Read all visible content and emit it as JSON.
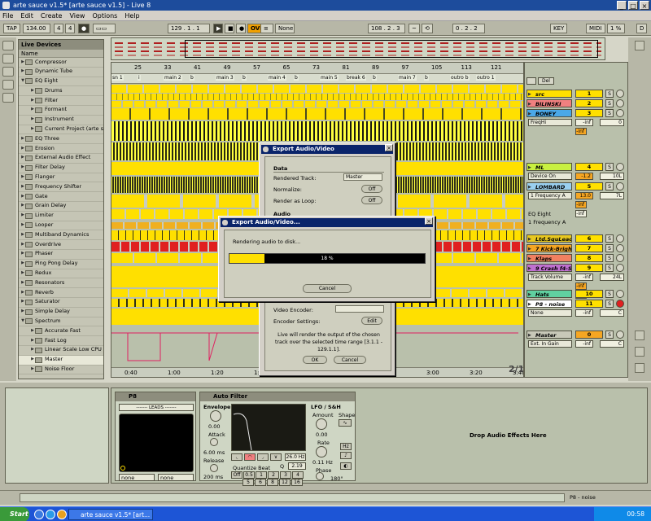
{
  "window": {
    "title": "arte sauce v1.5*  [arte sauce v1.5]  - Live 8"
  },
  "menu": [
    "File",
    "Edit",
    "Create",
    "View",
    "Options",
    "Help"
  ],
  "transport": {
    "tap": "TAP",
    "tempo": "134.00",
    "meter_num": "4",
    "meter_den": "4",
    "position": "129 . 1 . 1",
    "ovr": "OVR",
    "quantize": "None",
    "loop_start": "108 . 2 . 3",
    "loop_length": "0 . 2 . 2",
    "key": "KEY",
    "midi": "MIDI",
    "cpu": "1 %",
    "d": "D"
  },
  "browser": {
    "header": "Live Devices",
    "name_col": "Name",
    "items": [
      {
        "label": "Compressor",
        "depth": 1
      },
      {
        "label": "Dynamic Tube",
        "depth": 1
      },
      {
        "label": "EQ Eight",
        "depth": 1,
        "open": true
      },
      {
        "label": "Drums",
        "depth": 2
      },
      {
        "label": "Filter",
        "depth": 2
      },
      {
        "label": "Formant",
        "depth": 2
      },
      {
        "label": "Instrument",
        "depth": 2
      },
      {
        "label": "Current Project (arte sa",
        "depth": 2
      },
      {
        "label": "EQ Three",
        "depth": 1
      },
      {
        "label": "Erosion",
        "depth": 1
      },
      {
        "label": "External Audio Effect",
        "depth": 1
      },
      {
        "label": "Filter Delay",
        "depth": 1
      },
      {
        "label": "Flanger",
        "depth": 1
      },
      {
        "label": "Frequency Shifter",
        "depth": 1
      },
      {
        "label": "Gate",
        "depth": 1
      },
      {
        "label": "Grain Delay",
        "depth": 1
      },
      {
        "label": "Limiter",
        "depth": 1
      },
      {
        "label": "Looper",
        "depth": 1
      },
      {
        "label": "Multiband Dynamics",
        "depth": 1
      },
      {
        "label": "Overdrive",
        "depth": 1
      },
      {
        "label": "Phaser",
        "depth": 1
      },
      {
        "label": "Ping Pong Delay",
        "depth": 1
      },
      {
        "label": "Redux",
        "depth": 1
      },
      {
        "label": "Resonators",
        "depth": 1
      },
      {
        "label": "Reverb",
        "depth": 1
      },
      {
        "label": "Saturator",
        "depth": 1
      },
      {
        "label": "Simple Delay",
        "depth": 1
      },
      {
        "label": "Spectrum",
        "depth": 1,
        "open": true
      },
      {
        "label": "Accurate Fast",
        "depth": 2
      },
      {
        "label": "Fast Log",
        "depth": 2
      },
      {
        "label": "Linear Scale Low CPU",
        "depth": 2
      },
      {
        "label": "Master",
        "depth": 2,
        "selected": true
      },
      {
        "label": "Noise Floor",
        "depth": 2
      }
    ]
  },
  "ruler": [
    "25",
    "33",
    "41",
    "49",
    "57",
    "65",
    "73",
    "81",
    "89",
    "97",
    "105",
    "113",
    "121"
  ],
  "locators": [
    "sn 1",
    "i",
    "main 2",
    "b",
    "main 3",
    "b",
    "main 4",
    "b",
    "main 5",
    "break 6",
    "b",
    "main 7",
    "b",
    "outro b",
    "outro 1"
  ],
  "time_ruler": [
    "0:40",
    "1:00",
    "1:20",
    "1:40",
    "2:00",
    "2:20",
    "2:40",
    "3:00",
    "3:20",
    "3:40"
  ],
  "page_indicator": "2/1",
  "mixer": {
    "del": "Del",
    "tracks": [
      {
        "name": "src",
        "num": "1",
        "color": "#ffe000"
      },
      {
        "name": "BILINSKI",
        "num": "2",
        "color": "#f08080"
      },
      {
        "name": "BONEY",
        "num": "3",
        "color": "#4aa8e8",
        "device": "FreqHi",
        "v1": "-inf",
        "v2": "0",
        "v3": "-inf"
      },
      {
        "name": "ML",
        "num": "4",
        "color": "#c8f040",
        "device": "Device On",
        "v1": "-1.2",
        "v2": "10L"
      },
      {
        "name": "LOMBARD",
        "num": "5",
        "color": "#9ad0f0",
        "device": "1 Frequency A",
        "v1": "13.0",
        "v2": "7L",
        "v3": "-inf",
        "v4": "-inf",
        "device2": "EQ Eight",
        "device3": "1 Frequency A"
      },
      {
        "name": "Ltd.SquLead",
        "num": "6",
        "color": "#e8c820"
      },
      {
        "name": "7 Kick-Brigh",
        "num": "7",
        "color": "#f5a623"
      },
      {
        "name": "Klaps",
        "num": "8",
        "color": "#f08060"
      },
      {
        "name": "9 Crash f4-S",
        "num": "9",
        "color": "#c070d0",
        "device": "Track Volume",
        "v1": "-inf",
        "v2": "24L",
        "v3": "-inf",
        "v4": "-inf"
      },
      {
        "name": "Hats",
        "num": "10",
        "color": "#60d0a0"
      },
      {
        "name": "P8 - noise",
        "num": "11",
        "color": "#ffffff",
        "device": "None",
        "v1": "-inf",
        "v2": "C"
      },
      {
        "name": "Master",
        "num": "0",
        "color": "#c8c8b8",
        "device": "Ext. In Gain",
        "v1": "-inf",
        "v2": "C"
      }
    ]
  },
  "export_back": {
    "title": "Export Audio/Video",
    "section_data": "Data",
    "rendered_track_label": "Rendered Track:",
    "rendered_track_value": "Master",
    "normalize_label": "Normalize:",
    "normalize_value": "Off",
    "render_loop_label": "Render as Loop:",
    "render_loop_value": "Off",
    "section_audio": "Audio",
    "video_encoder_label": "Video Encoder:",
    "encoder_settings_label": "Encoder Settings:",
    "encoder_settings_btn": "Edit",
    "info": "Live will render the output of the chosen track over the selected time range [3.1.1 - 129.1.1].",
    "ok": "OK",
    "cancel": "Cancel"
  },
  "export_front": {
    "title": "Export Audio/Video...",
    "message": "Rendering audio to disk...",
    "progress_percent": 18,
    "progress_label": "18 %",
    "cancel": "Cancel"
  },
  "device_view": {
    "instrument_title": "P8",
    "preset": "------- LEADS -------",
    "none_left": "none",
    "none_right": "none",
    "auto_filter_title": "Auto Filter",
    "envelope_label": "Envelope",
    "envelope_value": "0.00",
    "attack_label": "Attack",
    "attack_value": "6.00 ms",
    "release_label": "Release",
    "release_value": "200 ms",
    "freq_value": "26.0 Hz",
    "q_label": "Q",
    "q_value": "2.19",
    "quantize_label": "Quantize Beat",
    "quantize_row1": [
      "Off",
      "0.5",
      "1",
      "2",
      "3",
      "4"
    ],
    "quantize_row2": [
      "5",
      "6",
      "8",
      "12",
      "16"
    ],
    "lfo_label": "LFO / S&H",
    "amount_label": "Amount",
    "amount_value": "0.00",
    "shape_label": "Shape",
    "rate_label": "Rate",
    "rate_value": "0.11 Hz",
    "hz": "Hz",
    "phase_label": "Phase",
    "phase_value": "180°",
    "drop_text": "Drop Audio Effects Here"
  },
  "status": {
    "track": "P8 - noise"
  },
  "taskbar": {
    "start": "Start",
    "task": "arte sauce v1.5*  [art...",
    "clock": "00:58"
  }
}
